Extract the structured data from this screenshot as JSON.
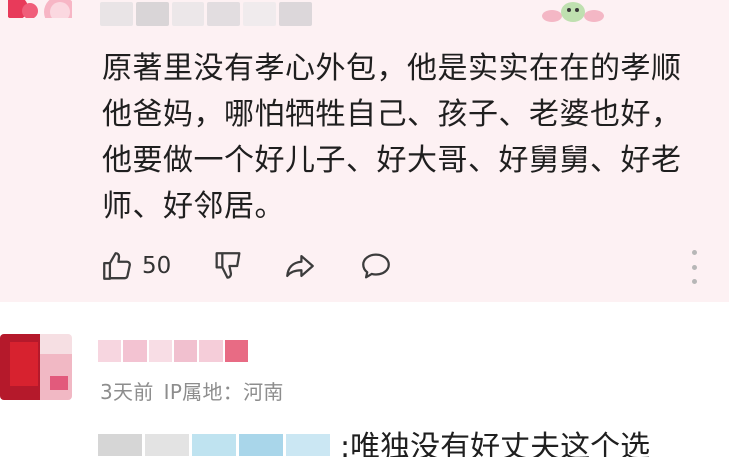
{
  "comment1": {
    "body": "原著里没有孝心外包，他是实实在在的孝顺他爸妈，哪怕牺牲自己、孩子、老婆也好，他要做一个好儿子、好大哥、好舅舅、好老师、好邻居。",
    "like_count": "50",
    "icons": [
      "like-icon",
      "dislike-icon",
      "share-icon",
      "reply-icon",
      "more-icon"
    ],
    "colors": {
      "background": "#fdf1f3",
      "icon": "#3c3c3c"
    }
  },
  "comment2": {
    "time": "3天前",
    "ip_location": "IP属地：河南",
    "reply_text": ":唯独没有好丈夫这个选"
  }
}
